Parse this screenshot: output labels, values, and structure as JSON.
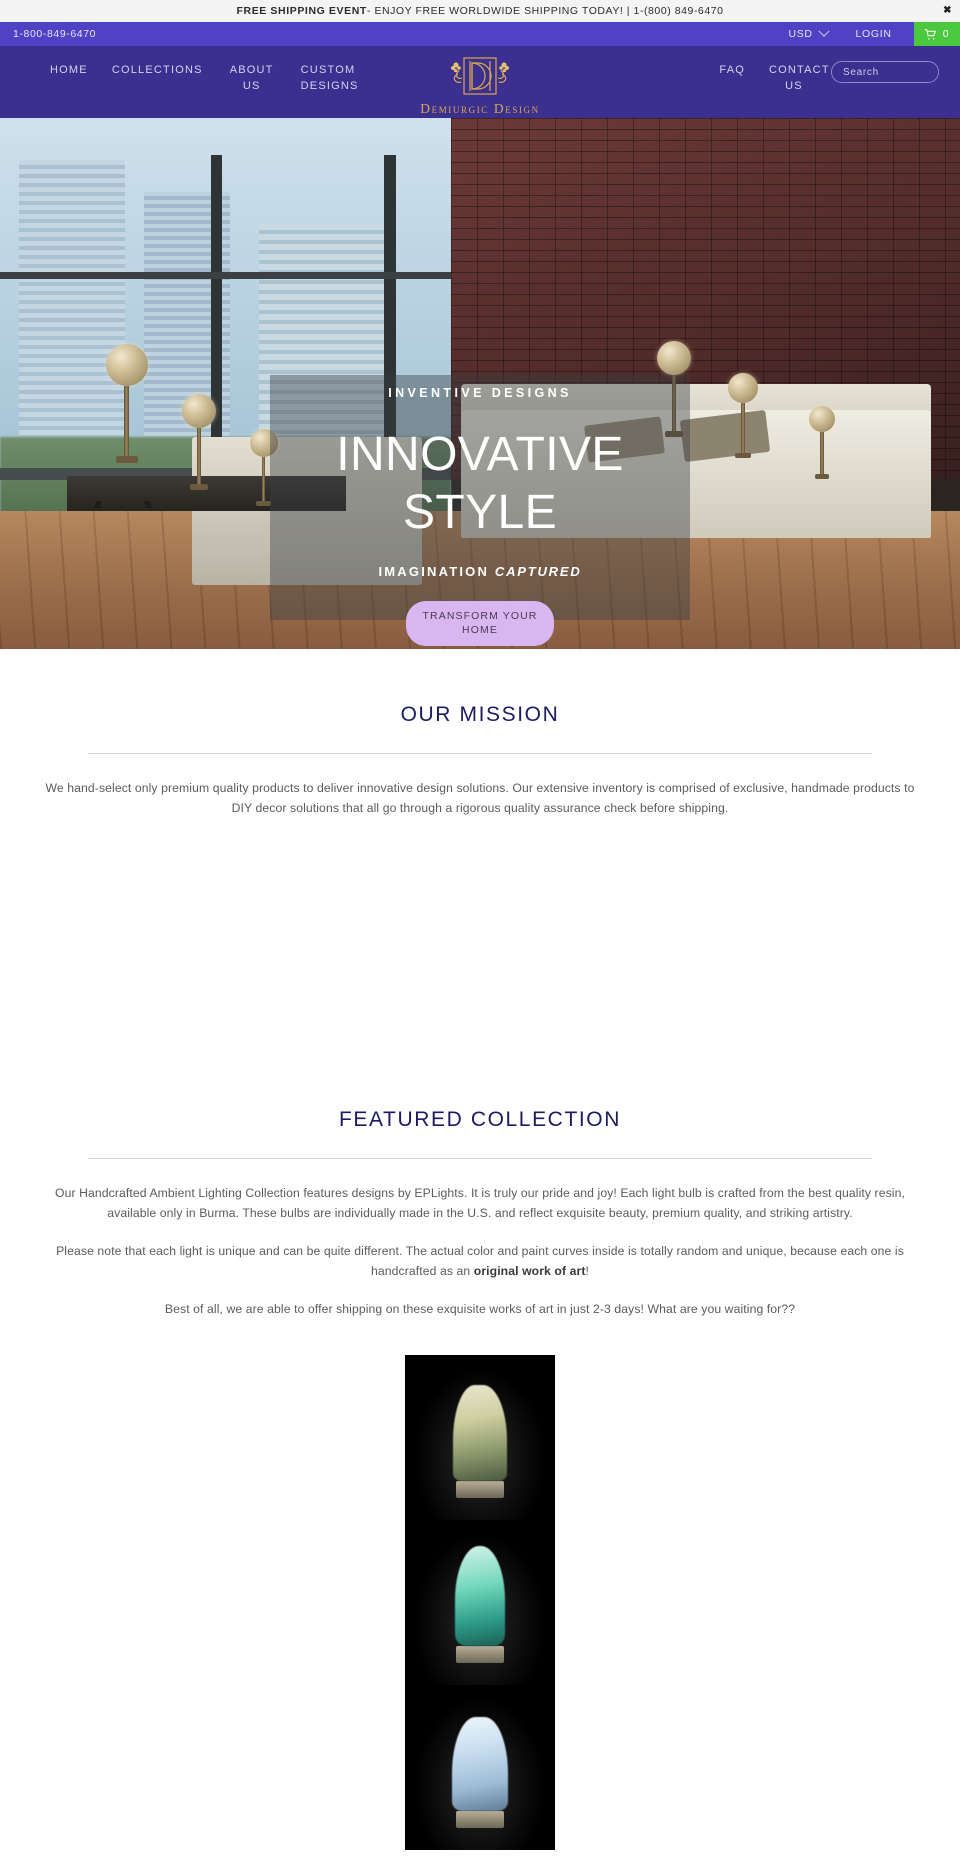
{
  "announcement": {
    "strong": "FREE SHIPPING EVENT",
    "rest": "- ENJOY FREE WORLDWIDE SHIPPING TODAY! | 1-(800) 849-6470",
    "close_label": "✖"
  },
  "utility": {
    "phone": "1-800-849-6470",
    "currency": "USD",
    "login": "LOGIN",
    "cart_count": "0"
  },
  "nav": {
    "left_items": [
      {
        "label": "HOME"
      },
      {
        "label": "COLLECTIONS"
      },
      {
        "label": "ABOUT US"
      },
      {
        "label": "CUSTOM DESIGNS"
      }
    ],
    "right_items": [
      {
        "label": "FAQ"
      },
      {
        "label": "CONTACT US"
      }
    ],
    "search_placeholder": "Search"
  },
  "logo": {
    "name": "Demiurgic Design",
    "tagline": "IMAGINATION CAPTURED"
  },
  "hero": {
    "eyebrow": "INVENTIVE DESIGNS",
    "title_line1": "INNOVATIVE",
    "title_line2": "STYLE",
    "sub_normal": "IMAGINATION ",
    "sub_italic": "CAPTURED",
    "cta": "TRANSFORM YOUR HOME"
  },
  "mission": {
    "title": "OUR MISSION",
    "body": "We hand-select only premium quality products to deliver innovative design solutions. Our extensive inventory is comprised of exclusive, handmade products to DIY decor solutions that all go through a rigorous quality assurance check before shipping."
  },
  "featured": {
    "title": "FEATURED COLLECTION",
    "p1": "Our Handcrafted Ambient Lighting Collection features designs by EPLights. It is truly our pride and joy! Each light bulb is crafted from the best quality resin, available only in Burma. These bulbs are individually made in the U.S. and reflect exquisite beauty, premium quality, and striking artistry.",
    "p2_before": "Please note that each light is unique and can be quite different. The actual color and paint curves inside is totally random and unique, because each one is handcrafted as an ",
    "p2_bold": "original work of art",
    "p2_after": "!",
    "p3": "Best of all, we are able to offer shipping on these exquisite works of art in just 2-3 days! What are you waiting for??"
  },
  "colors": {
    "utility_bar": "#4f42c4",
    "nav_bar": "#3b2f8f",
    "cart_green": "#4ac93f",
    "heading_navy": "#1d1a62",
    "cta_lavender": "#d9b6ef",
    "logo_gold": "#d8a94e"
  }
}
